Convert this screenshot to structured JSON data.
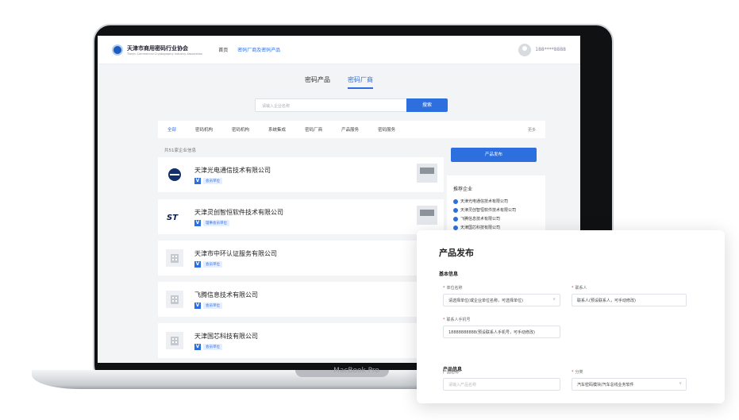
{
  "nav": {
    "logo_cn": "天津市商用密码行业协会",
    "logo_en": "Tianjin Commercial Cryptography Industry Association",
    "home": "首页",
    "mine": "密码厂商及密码产品",
    "user_phone": "188****8888"
  },
  "tabs": [
    "密码产品",
    "密码厂商"
  ],
  "search": {
    "placeholder": "请输入企业名称",
    "button": "搜索"
  },
  "categories": [
    "全部",
    "密码机构",
    "密码机构",
    "系统集成",
    "密码厂商",
    "产品服务",
    "密码服务"
  ],
  "more_label": "更多",
  "count_label": "共51家企业信息",
  "companies": [
    {
      "name": "天津光电通信技术有限公司",
      "tag": "会员单位"
    },
    {
      "name": "天津灵创智恒软件技术有限公司",
      "tag": "理事会员单位"
    },
    {
      "name": "天津市中环认证服务有限公司",
      "tag": "会员单位"
    },
    {
      "name": "飞腾信息技术有限公司",
      "tag": "会员单位"
    },
    {
      "name": "天津国芯科技有限公司",
      "tag": "会员单位"
    }
  ],
  "sidebar": {
    "publish_button": "产品发布",
    "section_title": "推荐企业",
    "items": [
      "天津光电通信技术有限公司",
      "天津灵创智恒软件技术有限公司",
      "飞腾信息技术有限公司",
      "天津国芯科技有限公司"
    ]
  },
  "popup": {
    "title": "产品发布",
    "section_basic": "基本信息",
    "org_label": "单位名称",
    "org_value": "请选择单位(或企业单位名称，可选择单位)",
    "contact_label": "联系人",
    "contact_value": "联系人(预设联系人，可手动修改)",
    "phone_label": "联系人手机号",
    "phone_value": "18888888888(预设联系人手机号，可手动修改)",
    "section_product": "产品信息",
    "product_name_label": "产品名称",
    "product_name_placeholder": "请输入产品名称",
    "category_label": "分类",
    "category_value": "汽车密码模块/汽车总线业务软件"
  },
  "device_label": "MacBook Pro"
}
